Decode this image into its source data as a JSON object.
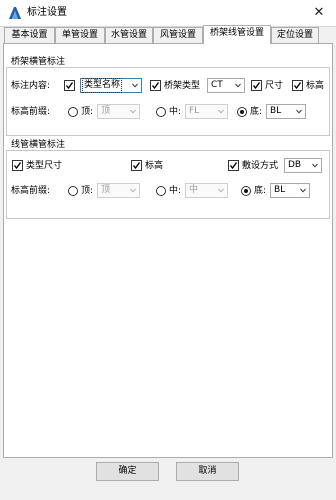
{
  "window": {
    "title": "标注设置",
    "close_glyph": "✕",
    "icon": "cad-logo-icon"
  },
  "tabs": [
    {
      "label": "基本设置",
      "active": false
    },
    {
      "label": "单管设置",
      "active": false
    },
    {
      "label": "水管设置",
      "active": false
    },
    {
      "label": "风管设置",
      "active": false
    },
    {
      "label": "桥架线管设置",
      "active": true
    },
    {
      "label": "定位设置",
      "active": false
    }
  ],
  "bridge_group": {
    "title": "桥架横管标注",
    "content_label": "标注内容:",
    "content_checked": true,
    "content_value": "类型名称",
    "type_label": "桥架类型",
    "type_checked": true,
    "type_value": "CT",
    "size_label": "尺寸",
    "size_checked": true,
    "elev_label": "标高",
    "elev_checked": true,
    "prefix_label": "标高前缀:",
    "top_label": "顶:",
    "top_value": "顶",
    "mid_label": "中:",
    "mid_value": "FL",
    "bottom_label": "底:",
    "bottom_value": "BL",
    "selected_radio": "bottom"
  },
  "conduit_group": {
    "title": "线管横管标注",
    "type_size_label": "类型尺寸",
    "type_size_checked": true,
    "elev_label": "标高",
    "elev_checked": true,
    "laying_label": "敷设方式",
    "laying_checked": true,
    "laying_value": "DB",
    "prefix_label": "标高前缀:",
    "top_label": "顶:",
    "top_value": "顶",
    "mid_label": "中:",
    "mid_value": "中",
    "bottom_label": "底:",
    "bottom_value": "BL",
    "selected_radio": "bottom"
  },
  "buttons": {
    "ok": "确定",
    "cancel": "取消"
  },
  "colors": {
    "client_bg": "#f0f0f0",
    "focus_border": "#3c7fb1",
    "disabled_text": "#9a9a9a"
  }
}
